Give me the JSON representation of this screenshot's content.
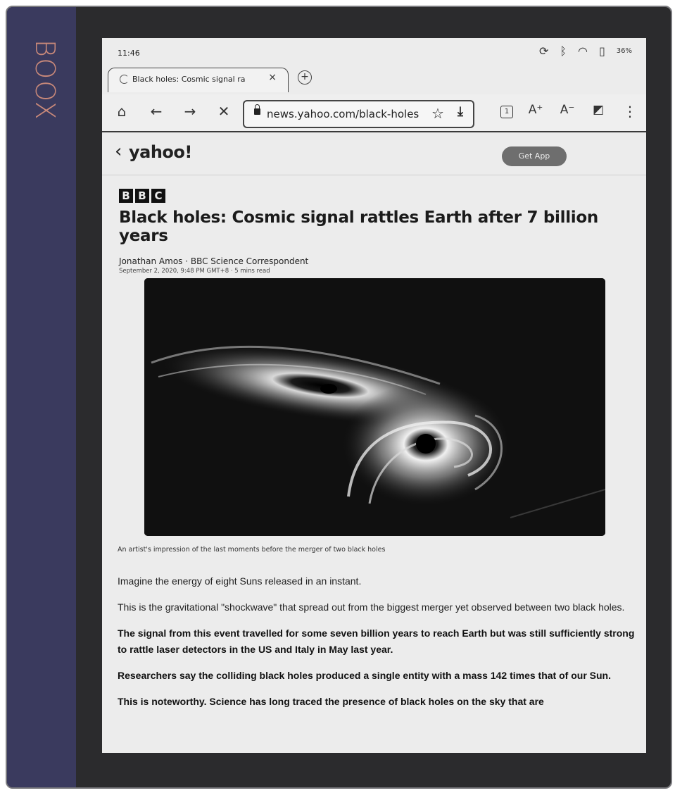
{
  "device": {
    "brand": "BOOX"
  },
  "status_bar": {
    "time": "11:46",
    "battery": "36%"
  },
  "tab": {
    "title": "Black holes: Cosmic signal ra",
    "close": "×",
    "new_tab": "+"
  },
  "toolbar": {
    "url": "news.yahoo.com/black-holes",
    "tab_count": "1"
  },
  "site": {
    "logo": "yahoo!",
    "back": "‹",
    "get_app": "Get App"
  },
  "article": {
    "publisher": [
      "B",
      "B",
      "C"
    ],
    "headline": "Black holes: Cosmic signal rattles Earth after 7 billion years",
    "author": "Jonathan Amos · BBC Science Correspondent",
    "date": "September 2, 2020, 9:48 PM GMT+8 · 5 mins read",
    "caption": "An artist's impression of the last moments before the merger of two black holes",
    "paragraphs": [
      "Imagine the energy of eight Suns released in an instant.",
      "This is the gravitational \"shockwave\" that spread out from the biggest merger yet observed between two black holes.",
      "The signal from this event travelled for some seven billion years to reach Earth but was still sufficiently strong to rattle laser detectors in the US and Italy in May last year.",
      "Researchers say the colliding black holes produced a single entity with a mass 142 times that of our Sun.",
      "This is noteworthy. Science has long traced the presence of black holes on the sky that are"
    ]
  }
}
